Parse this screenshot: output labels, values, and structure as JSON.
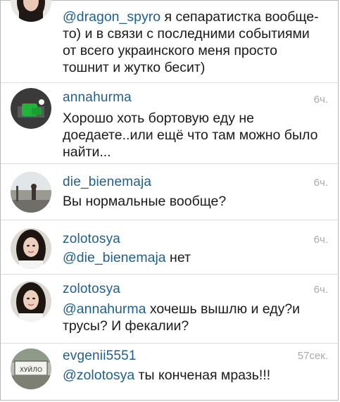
{
  "comments": [
    {
      "username": "",
      "time": "",
      "mention": "@dragon_spyro",
      "text": " я сепаратистка вообще-то) и в связи с последними событиями от всего украинского меня просто тошнит и жутко бесит)",
      "avatar_icon": "woman-portrait-avatar"
    },
    {
      "username": "annahurma",
      "time": "6ч.",
      "mention": "",
      "text": "Хорошо хоть бортовую еду не доедаете..или ещё что там можно было найти...",
      "avatar_icon": "green-object-avatar"
    },
    {
      "username": "die_bienemaja",
      "time": "6ч.",
      "mention": "",
      "text": "Вы нормальные вообще?",
      "avatar_icon": "outdoor-photo-avatar"
    },
    {
      "username": "zolotosya",
      "time": "6ч.",
      "mention": "@die_bienemaja",
      "text": " нет",
      "avatar_icon": "woman-portrait-avatar"
    },
    {
      "username": "zolotosya",
      "time": "6ч.",
      "mention": "@annahurma",
      "text": " хочешь вышлю и еду?и трусы? И фекалии?",
      "avatar_icon": "woman-portrait-avatar"
    },
    {
      "username": "evgenii5551",
      "time": "57сек.",
      "mention": "@zolotosya",
      "text": " ты конченая мразь!!!",
      "avatar_icon": "sign-photo-avatar"
    }
  ],
  "sign_text": "ХУЙЛО",
  "colors": {
    "username": "#1f5f8f",
    "timestamp": "#a9a9a9",
    "text": "#1a1a1a",
    "divider": "#dcdcdc"
  }
}
